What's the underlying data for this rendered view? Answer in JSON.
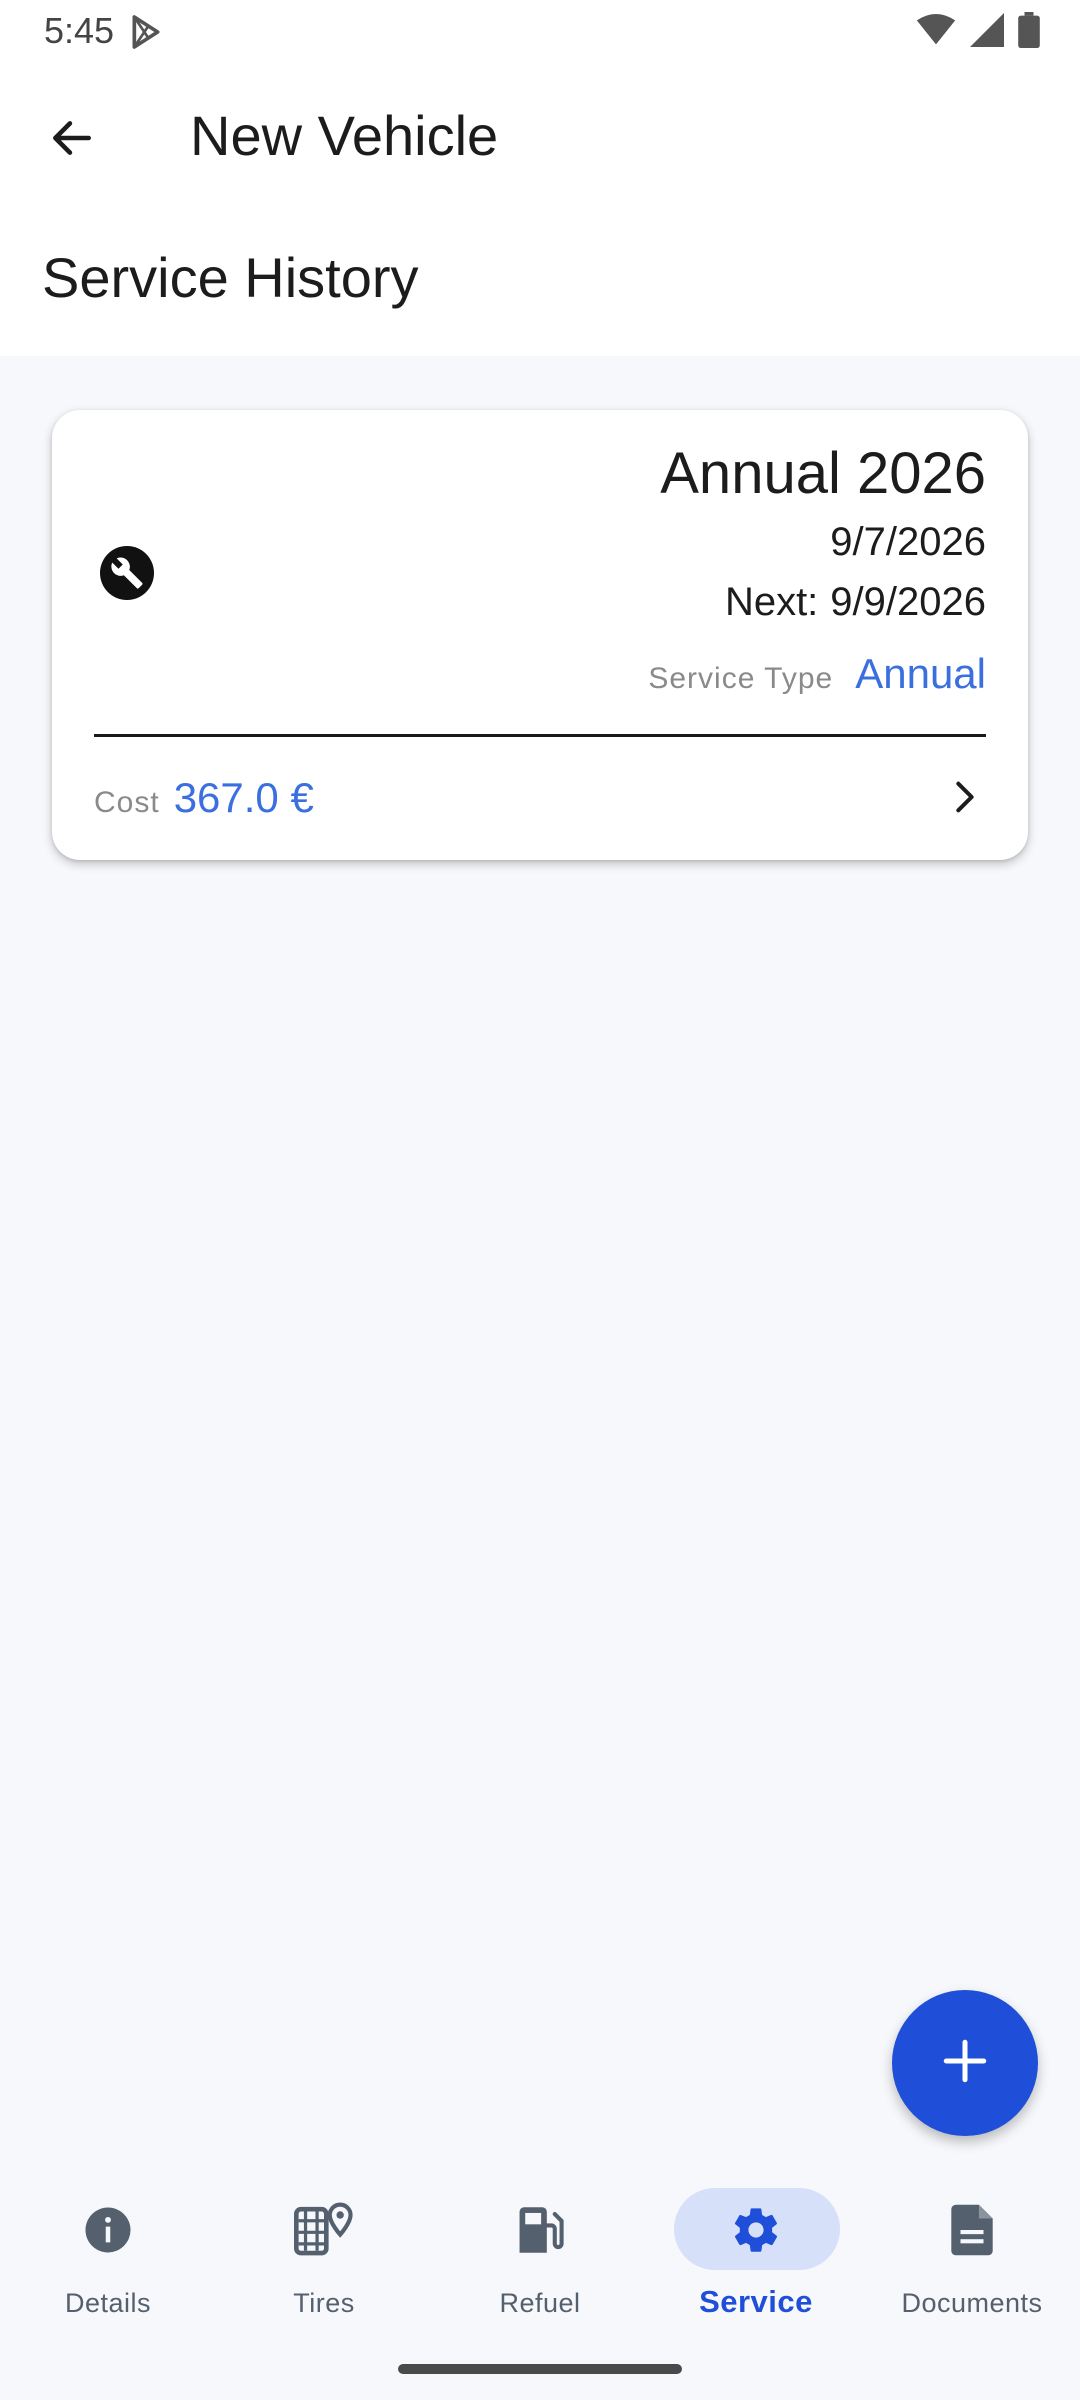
{
  "status_bar": {
    "time": "5:45",
    "icons": [
      "play-store-icon",
      "wifi-icon",
      "signal-icon",
      "battery-icon"
    ]
  },
  "app_bar": {
    "back_icon": "arrow-back-icon",
    "title": "New Vehicle"
  },
  "section": {
    "title": "Service History"
  },
  "service_card": {
    "icon": "wrench-icon",
    "title": "Annual 2026",
    "date": "9/7/2026",
    "next_label": "Next:",
    "next_date": "9/9/2026",
    "service_type_label": "Service Type",
    "service_type_value": "Annual",
    "cost_label": "Cost",
    "cost_value": "367.0 €",
    "chevron_icon": "chevron-right-icon"
  },
  "fab": {
    "icon": "plus-icon"
  },
  "bottom_nav": {
    "items": [
      {
        "label": "Details",
        "icon": "info-icon"
      },
      {
        "label": "Tires",
        "icon": "tire-location-icon"
      },
      {
        "label": "Refuel",
        "icon": "fuel-pump-icon"
      },
      {
        "label": "Service",
        "icon": "gear-icon",
        "active": true
      },
      {
        "label": "Documents",
        "icon": "document-icon"
      }
    ]
  },
  "colors": {
    "accent": "#1f4fd8",
    "link_blue": "#3b6fe0",
    "active_pill": "#d6e0f8",
    "background": "#f7f8fb"
  }
}
